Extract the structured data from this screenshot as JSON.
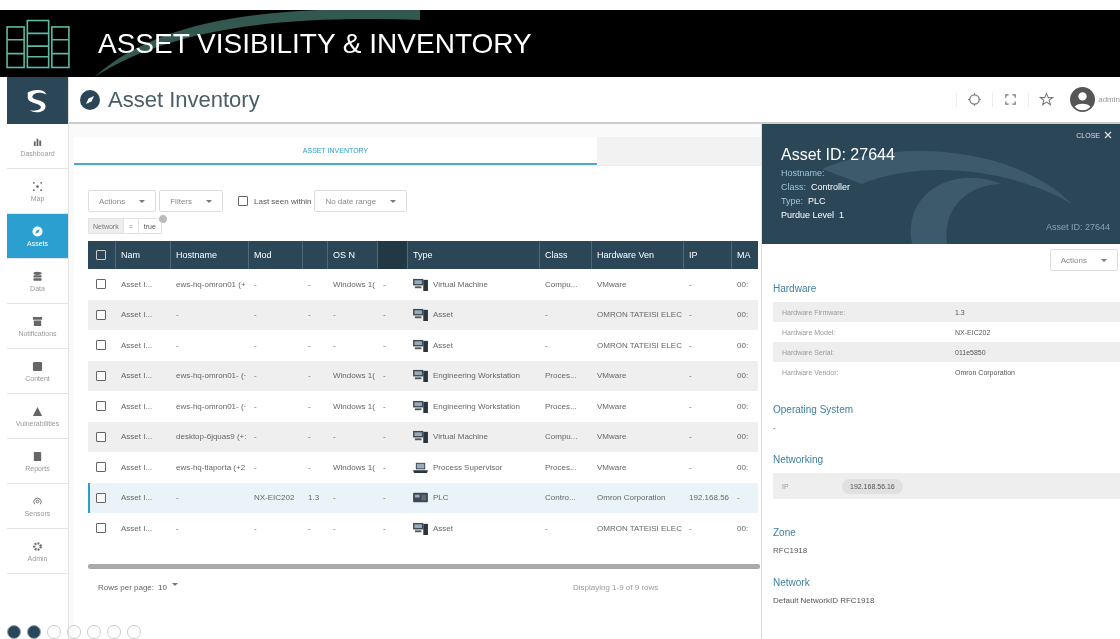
{
  "banner": {
    "title": "ASSET VISIBILITY & INVENTORY"
  },
  "header": {
    "title": "Asset Inventory",
    "user": "admin"
  },
  "sidebar": {
    "items": [
      {
        "label": "Dashboard",
        "selected": false
      },
      {
        "label": "Map",
        "selected": false
      },
      {
        "label": "Assets",
        "selected": true
      },
      {
        "label": "Data",
        "selected": false
      },
      {
        "label": "Notifications",
        "selected": false
      },
      {
        "label": "Content",
        "selected": false
      },
      {
        "label": "Vulnerabilities",
        "selected": false
      },
      {
        "label": "Reports",
        "selected": false
      },
      {
        "label": "Sensors",
        "selected": false
      },
      {
        "label": "Admin",
        "selected": false
      }
    ]
  },
  "tabs": [
    {
      "label": "ASSET INVENTORY",
      "selected": true
    },
    {
      "selected": false
    }
  ],
  "toolbar": {
    "actions": "Actions",
    "filters": "Filters",
    "last_seen": {
      "label": "Last seen within",
      "checked": false
    },
    "date_range": "No date range"
  },
  "filter_chip": {
    "field": "Network",
    "operator": "=",
    "value": "true"
  },
  "table": {
    "select_all_checked": false,
    "columns": [
      "Nam",
      "Hostname",
      "Mod",
      "",
      "OS N",
      "",
      "Type",
      "Class",
      "Hardware Ven",
      "IP",
      "MA"
    ],
    "rows": [
      {
        "checked": false,
        "selected": false,
        "kind": "computer",
        "cells": [
          "Asset I...",
          "ews-hq-omron01 (+",
          "-",
          "-",
          "Windows 1(",
          "-",
          "Virtual Machine",
          "Compu...",
          "VMware",
          "-",
          "00:"
        ]
      },
      {
        "checked": false,
        "selected": false,
        "kind": "computer",
        "cells": [
          "Asset I...",
          "-",
          "-",
          "-",
          "-",
          "-",
          "Asset",
          "-",
          "OMRON TATEISI ELEC",
          "-",
          "00:"
        ]
      },
      {
        "checked": false,
        "selected": false,
        "kind": "computer",
        "cells": [
          "Asset I...",
          "-",
          "-",
          "-",
          "-",
          "-",
          "Asset",
          "-",
          "OMRON TATEISI ELEC",
          "-",
          "00:"
        ]
      },
      {
        "checked": false,
        "selected": false,
        "kind": "computer",
        "cells": [
          "Asset I...",
          "ews-hq-omron01- (·",
          "-",
          "-",
          "Windows 1(",
          "-",
          "Engineering Workstation",
          "Proces...",
          "VMware",
          "-",
          "00:"
        ]
      },
      {
        "checked": false,
        "selected": false,
        "kind": "computer",
        "cells": [
          "Asset I...",
          "ews-hq-omron01- (·",
          "-",
          "-",
          "Windows 1(",
          "-",
          "Engineering Workstation",
          "Proces...",
          "VMware",
          "-",
          "00:"
        ]
      },
      {
        "checked": false,
        "selected": false,
        "kind": "computer",
        "cells": [
          "Asset I...",
          "desktop-6jquas9 (+:",
          "-",
          "-",
          "-",
          "-",
          "Virtual Machine",
          "Compu...",
          "VMware",
          "-",
          "00:"
        ]
      },
      {
        "checked": false,
        "selected": false,
        "kind": "supervisor",
        "cells": [
          "Asset I...",
          "ews-hq-tiaporta (+2",
          "-",
          "-",
          "Windows 1(",
          "-",
          "Process Supervisor",
          "Proces...",
          "VMware",
          "-",
          "00:"
        ]
      },
      {
        "checked": false,
        "selected": true,
        "kind": "plc",
        "cells": [
          "Asset I...",
          "-",
          "NX-EIC202",
          "1.3",
          "-",
          "-",
          "PLC",
          "Contro...",
          "Omron Corporation",
          "192.168.56",
          "-"
        ]
      },
      {
        "checked": false,
        "selected": false,
        "kind": "computer",
        "cells": [
          "Asset I...",
          "-",
          "-",
          "-",
          "-",
          "-",
          "Asset",
          "-",
          "OMRON TATEISI ELEC",
          "-",
          "00:"
        ]
      }
    ],
    "rows_per_page_label": "Rows per page:",
    "rows_per_page": "10",
    "summary": "Displaying 1-9 of 9 rows"
  },
  "panel": {
    "close": "CLOSE",
    "title": "Asset ID: 27644",
    "facts": [
      {
        "label": "Hostname:"
      },
      {
        "label": "Class:",
        "value": "Controller"
      },
      {
        "label": "Type:",
        "value": "PLC"
      },
      {
        "label": "Purdue Level",
        "value": "1"
      }
    ],
    "corner_id": "Asset ID: 27644",
    "actions": "Actions",
    "hardware": {
      "title": "Hardware",
      "rows": [
        {
          "label": "Hardware Firmware:",
          "value": "1.3"
        },
        {
          "label": "Hardware Model:",
          "value": "NX-EIC202"
        },
        {
          "label": "Hardware Serial:",
          "value": "011e5850"
        },
        {
          "label": "Hardware Vendor:",
          "value": "Omron Corporation"
        }
      ]
    },
    "os": {
      "title": "Operating System",
      "value": "-"
    },
    "networking": {
      "title": "Networking",
      "label": "IP",
      "value": "192.168.56.16"
    },
    "zone": {
      "title": "Zone",
      "value": "RFC1918"
    },
    "network": {
      "title": "Network",
      "value": "Default NetworkID RFC1918"
    }
  }
}
